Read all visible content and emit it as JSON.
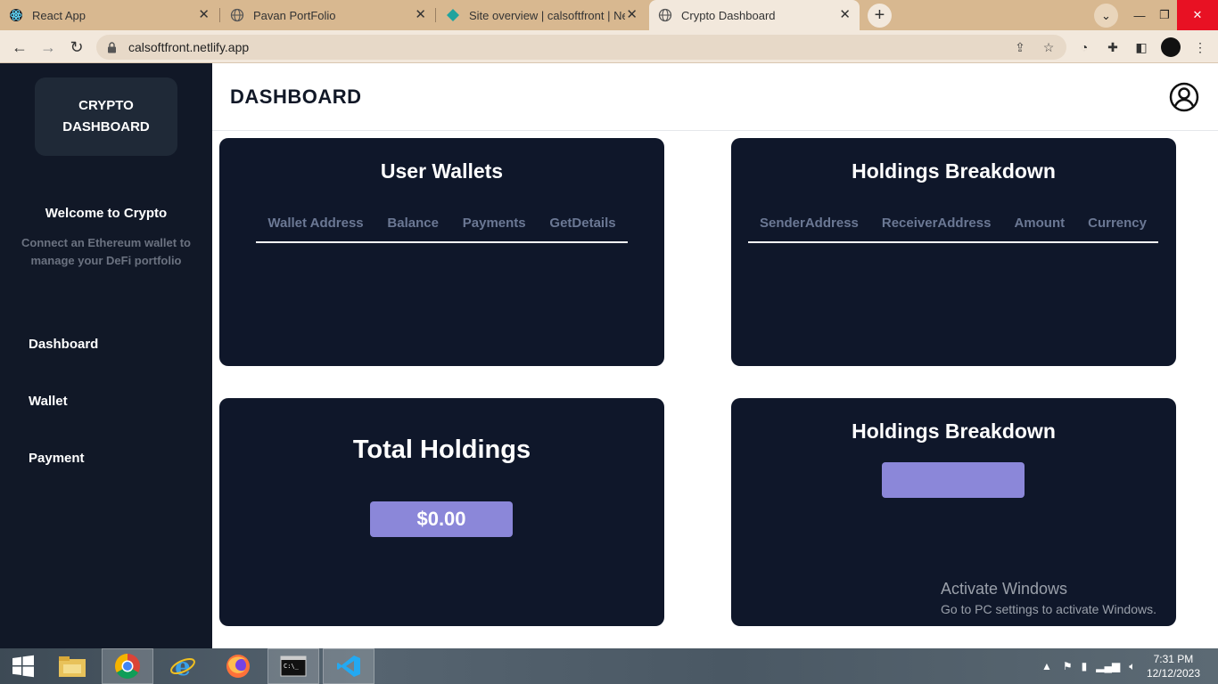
{
  "browser": {
    "tabs": [
      {
        "title": "React App",
        "icon": "react-icon"
      },
      {
        "title": "Pavan PortFolio",
        "icon": "globe-icon"
      },
      {
        "title": "Site overview | calsoftfront | Netl",
        "icon": "netlify-icon"
      },
      {
        "title": "Crypto Dashboard",
        "icon": "globe-icon",
        "active": true
      }
    ],
    "url": "calsoftfront.netlify.app",
    "accent": "#d8b890"
  },
  "sidebar": {
    "brand_line1": "CRYPTO",
    "brand_line2": "DASHBOARD",
    "welcome": "Welcome to Crypto",
    "connect_text": "Connect an Ethereum wallet to manage your DeFi portfolio",
    "nav": [
      {
        "label": "Dashboard"
      },
      {
        "label": "Wallet"
      },
      {
        "label": "Payment"
      }
    ]
  },
  "header": {
    "title": "DASHBOARD"
  },
  "cards": {
    "user_wallets": {
      "title": "User Wallets",
      "columns": [
        "Wallet Address",
        "Balance",
        "Payments",
        "GetDetails"
      ]
    },
    "holdings_table": {
      "title": "Holdings Breakdown",
      "columns": [
        "SenderAddress",
        "ReceiverAddress",
        "Amount",
        "Currency"
      ]
    },
    "total_holdings": {
      "title": "Total Holdings",
      "value": "$0.00"
    },
    "holdings_chart": {
      "title": "Holdings Breakdown",
      "value": ""
    }
  },
  "watermark": {
    "line1": "Activate Windows",
    "line2": "Go to PC settings to activate Windows."
  },
  "taskbar": {
    "time": "7:31 PM",
    "date": "12/12/2023"
  },
  "colors": {
    "sidebar_bg": "#111827",
    "card_bg": "#0f172a",
    "pill": "#8b87d9",
    "muted_text": "#6b7894"
  }
}
